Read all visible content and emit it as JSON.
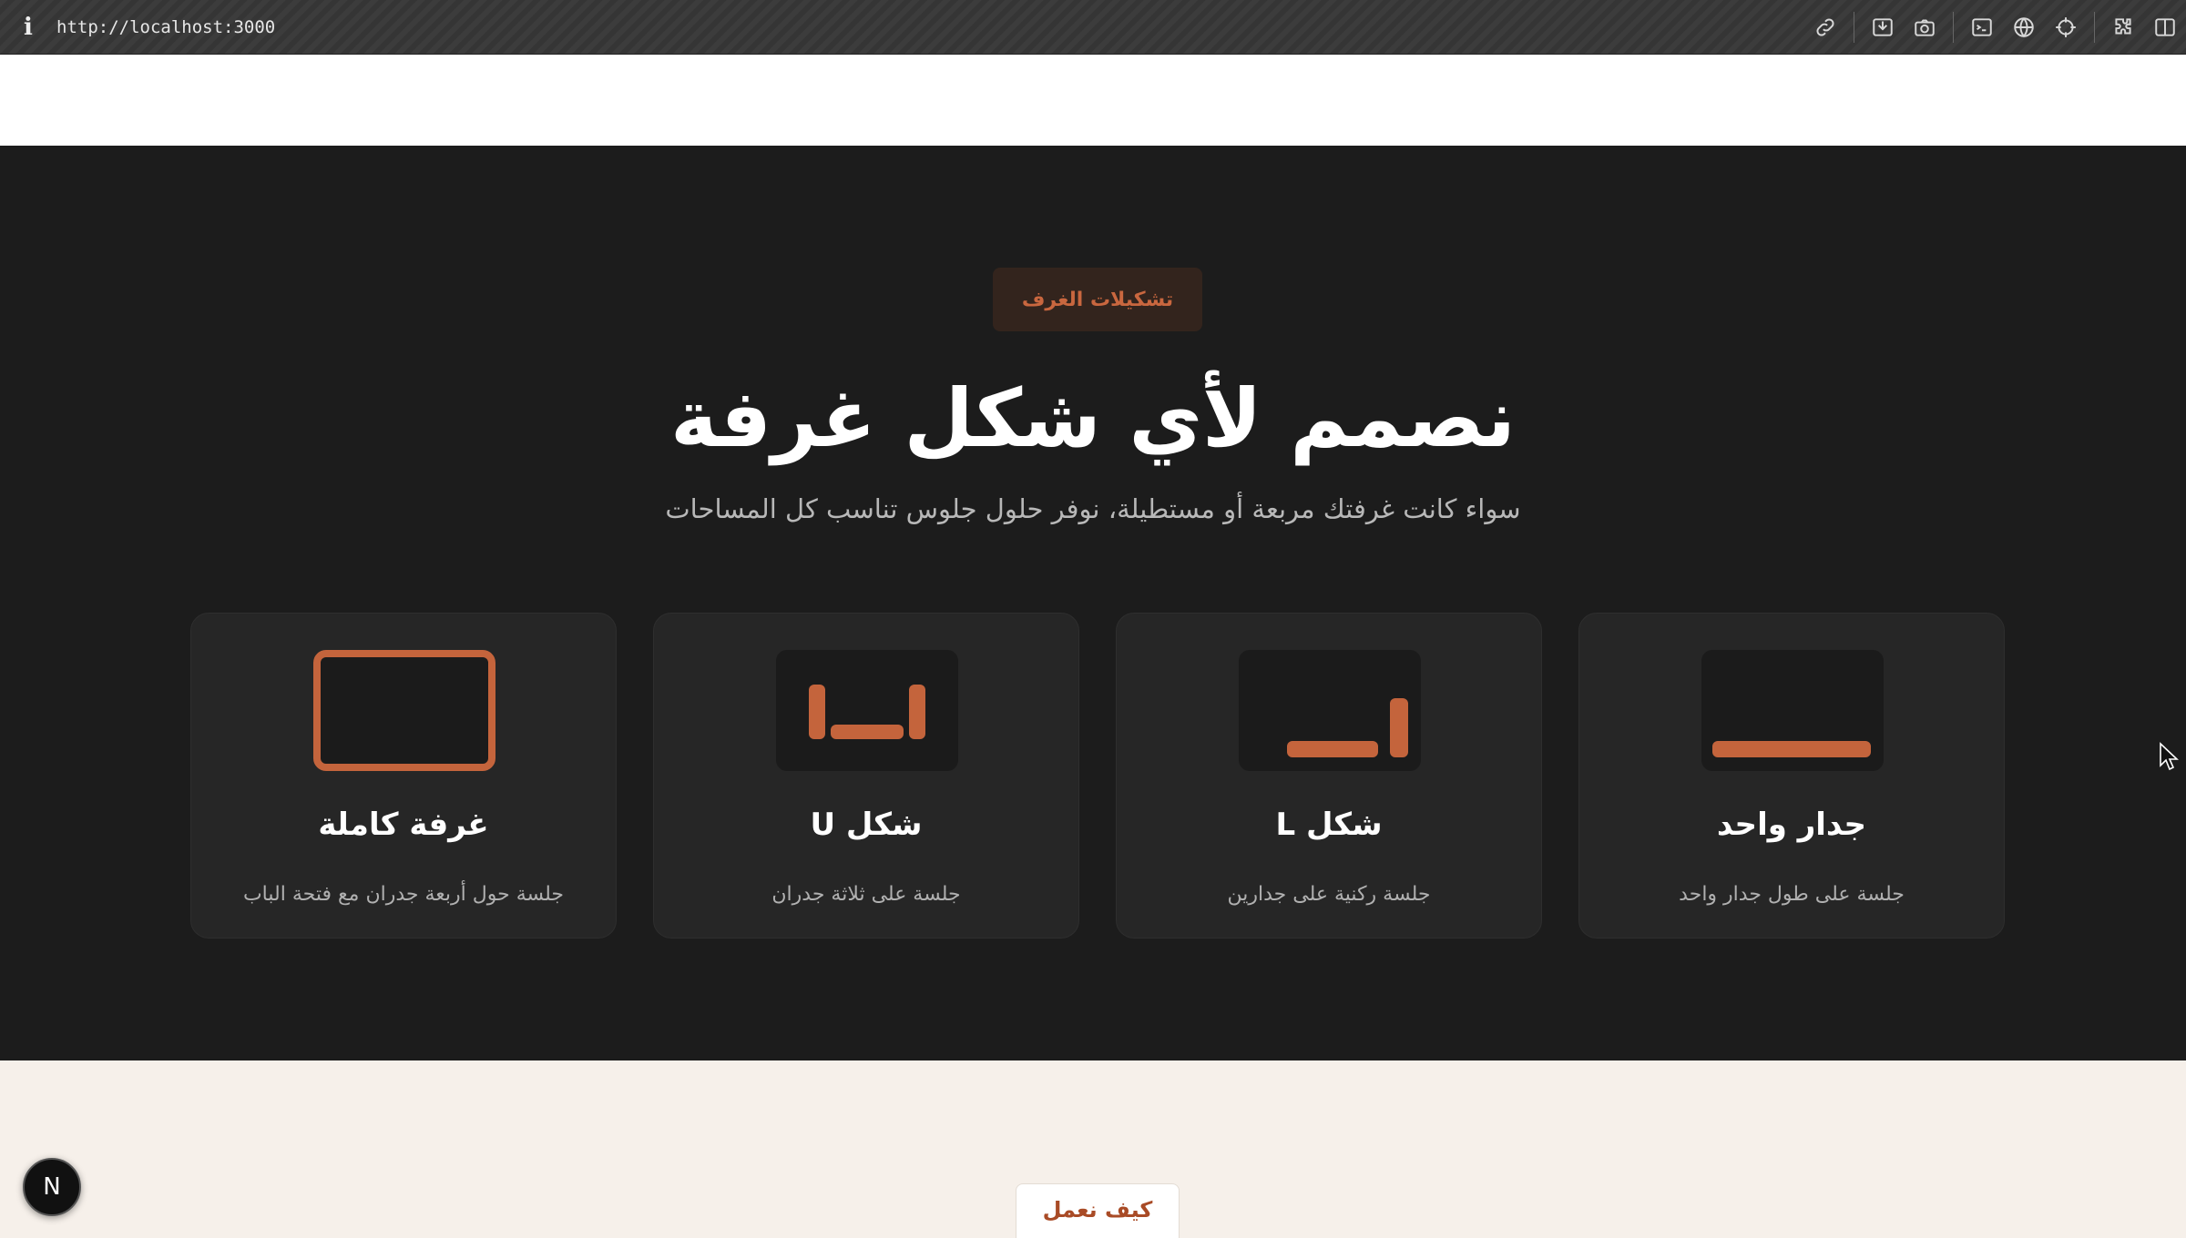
{
  "browser": {
    "url": "http://localhost:3000",
    "icons": [
      "link-icon",
      "screenshot-area-icon",
      "camera-icon",
      "terminal-icon",
      "globe-icon",
      "crosshair-icon",
      "extensions-icon",
      "sidebar-icon"
    ]
  },
  "section": {
    "badge": "تشكيلات الغرف",
    "headline": "نصمم لأي شكل غرفة",
    "subtitle": "سواء كانت غرفتك مربعة أو مستطيلة، نوفر حلول جلوس تناسب كل المساحات"
  },
  "cards": [
    {
      "title": "جدار واحد",
      "desc": "جلسة على طول جدار واحد"
    },
    {
      "title": "شكل L",
      "desc": "جلسة ركنية على جدارين"
    },
    {
      "title": "شكل U",
      "desc": "جلسة على ثلاثة جدران"
    },
    {
      "title": "غرفة كاملة",
      "desc": "جلسة حول أربعة جدران مع فتحة الباب"
    }
  ],
  "next_section": {
    "badge": "كيف نعمل"
  },
  "dev_badge": "N",
  "colors": {
    "accent": "#c4643c",
    "dark_bg": "#1c1c1c",
    "card_bg": "#262626",
    "beige_bg": "#f6f0ea"
  }
}
